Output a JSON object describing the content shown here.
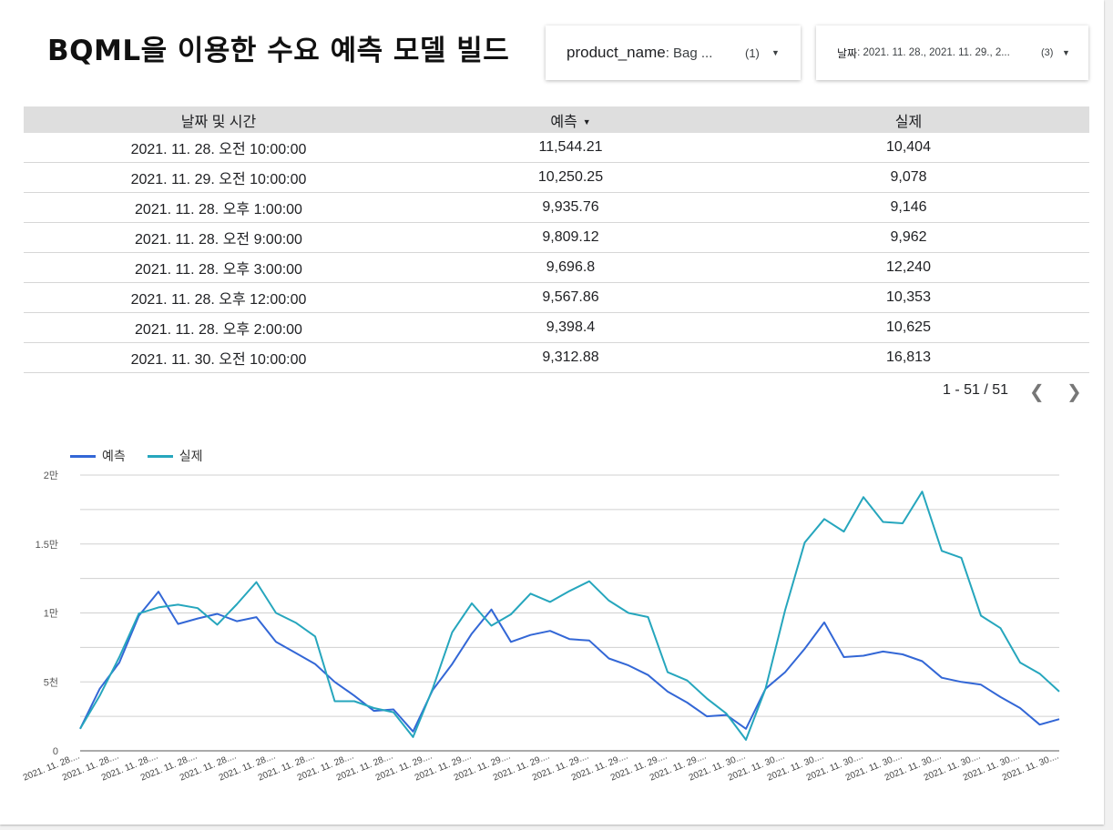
{
  "header": {
    "title": "BQML을 이용한 수요 예측 모델 빌드"
  },
  "filters": {
    "product": {
      "label": "product_name",
      "value": ": Bag ...",
      "count": "(1)"
    },
    "date": {
      "label": "날짜",
      "value": ": 2021. 11. 28., 2021. 11. 29., 2...",
      "count": "(3)"
    }
  },
  "table": {
    "headers": {
      "datetime": "날짜 및 시간",
      "forecast": "예측",
      "actual": "실제"
    },
    "rows": [
      {
        "datetime": "2021. 11. 28. 오전 10:00:00",
        "forecast": "11,544.21",
        "actual": "10,404"
      },
      {
        "datetime": "2021. 11. 29. 오전 10:00:00",
        "forecast": "10,250.25",
        "actual": "9,078"
      },
      {
        "datetime": "2021. 11. 28. 오후 1:00:00",
        "forecast": "9,935.76",
        "actual": "9,146"
      },
      {
        "datetime": "2021. 11. 28. 오전 9:00:00",
        "forecast": "9,809.12",
        "actual": "9,962"
      },
      {
        "datetime": "2021. 11. 28. 오후 3:00:00",
        "forecast": "9,696.8",
        "actual": "12,240"
      },
      {
        "datetime": "2021. 11. 28. 오후 12:00:00",
        "forecast": "9,567.86",
        "actual": "10,353"
      },
      {
        "datetime": "2021. 11. 28. 오후 2:00:00",
        "forecast": "9,398.4",
        "actual": "10,625"
      },
      {
        "datetime": "2021. 11. 30. 오전 10:00:00",
        "forecast": "9,312.88",
        "actual": "16,813"
      }
    ],
    "pagination": "1 - 51 / 51"
  },
  "icons": {
    "sort": "caret-down-icon",
    "prev": "chevron-left-icon",
    "next": "chevron-right-icon",
    "dropdown": "caret-down-icon"
  },
  "chart_data": {
    "type": "line",
    "title": "",
    "xlabel": "",
    "ylabel": "",
    "ylim": [
      0,
      20000
    ],
    "y_ticks": [
      0,
      5000,
      10000,
      15000,
      20000
    ],
    "y_tick_labels": [
      "0",
      "5천",
      "1만",
      "1.5만",
      "2만"
    ],
    "grid": true,
    "legend_position": "top-left",
    "x_tick_labels": [
      "2021. 11. 28....",
      "2021. 11. 28....",
      "2021. 11. 28....",
      "2021. 11. 28....",
      "2021. 11. 28....",
      "2021. 11. 28....",
      "2021. 11. 28....",
      "2021. 11. 28....",
      "2021. 11. 28....",
      "2021. 11. 29....",
      "2021. 11. 29....",
      "2021. 11. 29....",
      "2021. 11. 29....",
      "2021. 11. 29....",
      "2021. 11. 29....",
      "2021. 11. 29....",
      "2021. 11. 29....",
      "2021. 11. 30....",
      "2021. 11. 30....",
      "2021. 11. 30....",
      "2021. 11. 30....",
      "2021. 11. 30....",
      "2021. 11. 30....",
      "2021. 11. 30....",
      "2021. 11. 30....",
      "2021. 11. 30...."
    ],
    "series": [
      {
        "name": "예측",
        "color": "#3367d6",
        "values": [
          1600,
          4500,
          6400,
          9800,
          11544,
          9200,
          9600,
          9935,
          9400,
          9697,
          7900,
          7100,
          6300,
          5000,
          4000,
          2900,
          3000,
          1400,
          4400,
          6300,
          8500,
          10250,
          7900,
          8400,
          8700,
          8100,
          8000,
          6700,
          6200,
          5500,
          4300,
          3500,
          2500,
          2600,
          1600,
          4500,
          5700,
          7400,
          9313,
          6800,
          6900,
          7200,
          7000,
          6500,
          5300,
          5000,
          4800,
          3900,
          3100,
          1900,
          2300
        ]
      },
      {
        "name": "실제",
        "color": "#26a6bd",
        "values": [
          1600,
          4000,
          6800,
          9962,
          10404,
          10600,
          10353,
          9146,
          10625,
          12240,
          10000,
          9300,
          8300,
          3600,
          3600,
          3100,
          2800,
          1000,
          4500,
          8600,
          10700,
          9078,
          9900,
          11400,
          10800,
          11600,
          12300,
          10900,
          10000,
          9700,
          5700,
          5100,
          3800,
          2700,
          800,
          4500,
          10200,
          15100,
          16813,
          15900,
          18400,
          16600,
          16500,
          18800,
          14500,
          14000,
          9800,
          8900,
          6400,
          5600,
          4300
        ]
      }
    ]
  }
}
